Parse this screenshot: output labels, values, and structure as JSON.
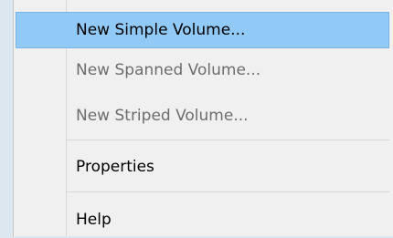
{
  "menu": {
    "items": [
      {
        "label": "New Simple Volume...",
        "state": "highlighted"
      },
      {
        "label": "New Spanned Volume...",
        "state": "disabled"
      },
      {
        "label": "New Striped Volume...",
        "state": "disabled"
      },
      {
        "label": "Properties",
        "state": "enabled"
      },
      {
        "label": "Help",
        "state": "enabled"
      }
    ],
    "colors": {
      "highlight": "#91c9f7",
      "highlight_border": "#7ab4e6",
      "disabled_text": "#6d6d6d",
      "menu_background": "#f0f0f0"
    }
  }
}
